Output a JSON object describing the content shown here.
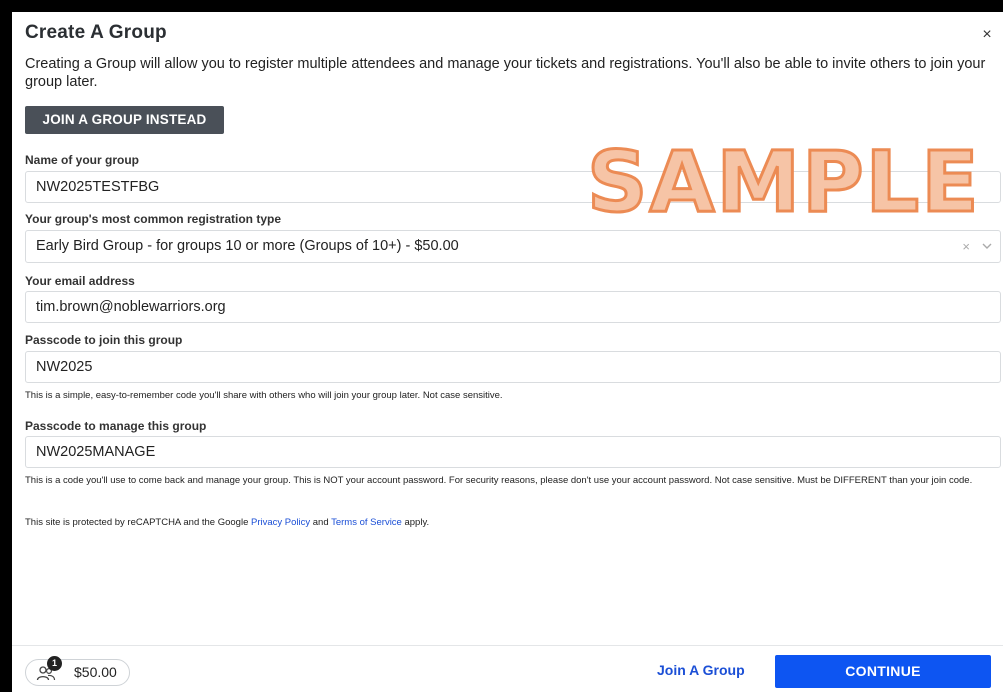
{
  "modal": {
    "title": "Create A Group",
    "close_glyph": "×",
    "intro": "Creating a Group will allow you to register multiple attendees and manage your tickets and registrations. You'll also be able to invite others to join your group later.",
    "join_instead_label": "JOIN A GROUP INSTEAD"
  },
  "form": {
    "group_name": {
      "label": "Name of your group",
      "value": "NW2025TESTFBG"
    },
    "registration_type": {
      "label": "Your group's most common registration type",
      "value": "Early Bird Group - for groups 10 or more (Groups of 10+) - $50.00",
      "clear_glyph": "×",
      "chevron_glyph": "⌄"
    },
    "email": {
      "label": "Your email address",
      "value": "tim.brown@noblewarriors.org"
    },
    "join_passcode": {
      "label": "Passcode to join this group",
      "value": "NW2025",
      "help": "This is a simple, easy-to-remember code you'll share with others who will join your group later. Not case sensitive."
    },
    "manage_passcode": {
      "label": "Passcode to manage this group",
      "value": "NW2025MANAGE",
      "help": "This is a code you'll use to come back and manage your group. This is NOT your account password. For security reasons, please don't use your account password. Not case sensitive. Must be DIFFERENT than your join code."
    },
    "recaptcha": {
      "prefix": "This site is protected by reCAPTCHA and the Google ",
      "privacy_link": "Privacy Policy",
      "middle": " and ",
      "terms_link": "Terms of Service",
      "suffix": " apply."
    }
  },
  "watermark": "SAMPLE",
  "footer": {
    "attendee_count": "1",
    "cart_total": "$50.00",
    "join_group_link": "Join A Group",
    "continue_label": "CONTINUE"
  },
  "colors": {
    "primary_button": "#0d55f2",
    "secondary_button": "#4a5058",
    "link": "#1b4fd6",
    "watermark_fill": "#f6c4a6",
    "watermark_stroke": "#ec8b54"
  },
  "icons": {
    "close": "close-icon",
    "people": "people-icon",
    "clear": "clear-icon",
    "chevron": "chevron-down-icon"
  }
}
